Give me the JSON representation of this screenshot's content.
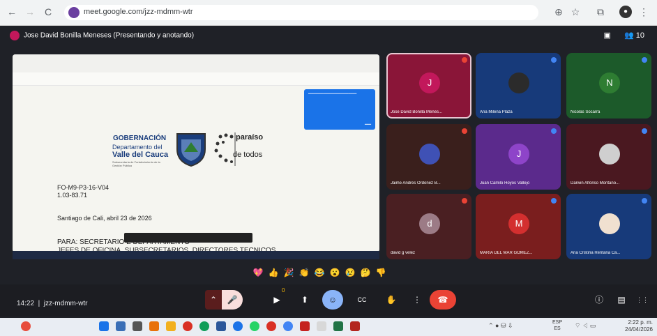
{
  "browser": {
    "url": "meet.google.com/jzz-mdmm-wtr",
    "back_icon": "←",
    "forward_icon": "→",
    "reload_icon": "C"
  },
  "meet": {
    "presenter_label": "Jose David Bonilla Meneses (Presentando y anotando)",
    "participant_count": "10",
    "time": "14:22",
    "meeting_code": "jzz-mdmm-wtr"
  },
  "slide": {
    "gob_line1": "GOBERNACIÓN",
    "gob_line2": "Departamento del",
    "gob_line3": "Valle del Cauca",
    "gob_line4": "Subsecretaría de Fortalecimiento de la Gestión Pública",
    "paraiso_line1": "paraíso",
    "paraiso_line2": "de todos",
    "doc_code": "FO-M9-P3-16-V04",
    "doc_number": "1.03-83.71",
    "doc_place_date": "Santiago de Cali, abril 23 de 2026",
    "doc_para_line1": "PARA: SECRETARIO                             E DEPARTAMENTO",
    "doc_para_line2": "JEFES   DE   OFICINA,   SUBSECRETARIOS,   DIRECTORES   TECNICOS"
  },
  "participants": [
    {
      "name": "Jose David Bonilla Menes...",
      "initial": "J",
      "bg": "#8a1538",
      "av": "#c2185b"
    },
    {
      "name": "Ana Milena Plaza",
      "initial": "",
      "bg": "#173a7a",
      "av": "#2b2b2b"
    },
    {
      "name": "Nicolas Socarra",
      "initial": "N",
      "bg": "#1c5a2a",
      "av": "#2e7d32"
    },
    {
      "name": "Jaime Andres Ordoñez B...",
      "initial": "",
      "bg": "#3a1f1c",
      "av": "#3f51b5"
    },
    {
      "name": "Juan Camilo Hoyos Vallejo",
      "initial": "J",
      "bg": "#5b2a8c",
      "av": "#8e44c9"
    },
    {
      "name": "Darwin Alfonso Montaño...",
      "initial": "",
      "bg": "#4a1820",
      "av": "#cfcfcf"
    },
    {
      "name": "david g velez",
      "initial": "d",
      "bg": "#4a1f22",
      "av": "#9c7b86"
    },
    {
      "name": "MARIA DEL MAR GOMEZ...",
      "initial": "M",
      "bg": "#7a1e1e",
      "av": "#d32f2f"
    },
    {
      "name": "Ana Cristina Rentaria Ca...",
      "initial": "",
      "bg": "#173a7a",
      "av": "#f0e0d0"
    }
  ],
  "reactions": [
    "💖",
    "👍",
    "🎉",
    "👏",
    "😂",
    "😮",
    "😢",
    "🤔",
    "👎"
  ],
  "controls": {
    "mic_icon": "🎤",
    "camera_icon": "▶",
    "present_icon": "⬆",
    "emoji_icon": "☺",
    "cc_icon": "CC",
    "hand_icon": "✋",
    "more_icon": "⋮",
    "hangup_icon": "☎",
    "info_icon": "ⓘ",
    "chat_icon": "▤",
    "apps_icon": "⋮⋮",
    "notification_badge": "0"
  },
  "taskbar": {
    "lang_line1": "ESP",
    "lang_line2": "ES",
    "clock_time": "2:22 p. m.",
    "clock_date": "24/04/2026"
  }
}
